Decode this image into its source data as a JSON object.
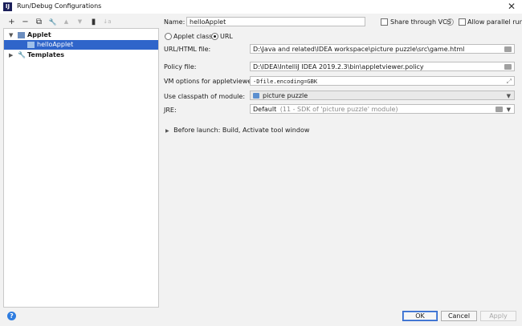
{
  "window": {
    "title": "Run/Debug Configurations",
    "app_icon": "IJ"
  },
  "toolbar": {
    "add": "+",
    "remove": "−",
    "copy": "⧉",
    "wrench": "🔧",
    "move_up": "▲",
    "move_down": "▼",
    "folder": "▮",
    "sort": "↓a"
  },
  "tree": {
    "group_label": "Applet",
    "child_label": "helloApplet",
    "templates_label": "Templates"
  },
  "form": {
    "name_label": "Name:",
    "name_value": "helloApplet",
    "share_label": "Share through VCS",
    "help_q": "?",
    "allow_parallel_label": "Allow parallel run",
    "applet_class_label": "Applet class",
    "url_label": "URL",
    "url_file_label": "URL/HTML file:",
    "url_file_value": "D:\\Java and related\\IDEA workspace\\picture puzzle\\src\\game.html",
    "policy_label": "Policy file:",
    "policy_value": "D:\\IDEA\\IntelliJ IDEA 2019.2.3\\bin\\appletviewer.policy",
    "vm_label": "VM options for appletviewer:",
    "vm_value": "-Dfile.encoding=GBK",
    "classpath_label": "Use classpath of module:",
    "classpath_value": "picture puzzle",
    "jre_label": "JRE:",
    "jre_value_main": "Default",
    "jre_value_detail": "(11 - SDK of 'picture puzzle' module)",
    "before_launch": "Before launch: Build, Activate tool window"
  },
  "buttons": {
    "ok": "OK",
    "cancel": "Cancel",
    "apply": "Apply",
    "help": "?"
  }
}
